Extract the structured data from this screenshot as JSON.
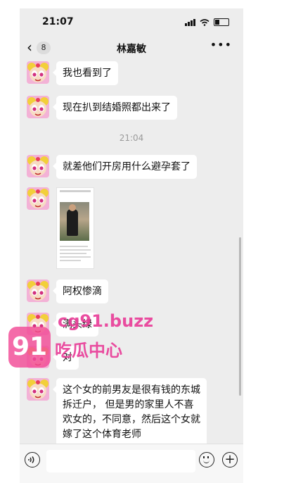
{
  "status_bar": {
    "time": "21:07"
  },
  "nav": {
    "back_count": "8",
    "title": "林嘉敏",
    "more": "•••"
  },
  "timestamp": "21:04",
  "messages": [
    {
      "text": "我也看到了"
    },
    {
      "text": "现在扒到结婚照都出来了"
    },
    {
      "text": "就差他们开房用什么避孕套了"
    },
    {
      "text": "阿权惨滴"
    },
    {
      "text": "满头绿"
    },
    {
      "text": "对"
    },
    {
      "text": "这个女的前男友是很有钱的东城拆迁户， 但是男的家里人不喜欢女的，不同意，然后这个女就嫁了这个体育老师"
    }
  ],
  "input": {
    "placeholder": ""
  },
  "watermark": {
    "logo": "91",
    "url": "cg91.buzz",
    "name": "吃瓜中心"
  },
  "icons": {
    "back": "chevron-left-icon",
    "more": "more-dots-icon",
    "voice": "voice-icon",
    "emoji": "emoji-icon",
    "plus": "plus-icon"
  },
  "colors": {
    "chat_bg": "#ededed",
    "bubble": "#ffffff",
    "watermark": "#e83a96"
  }
}
